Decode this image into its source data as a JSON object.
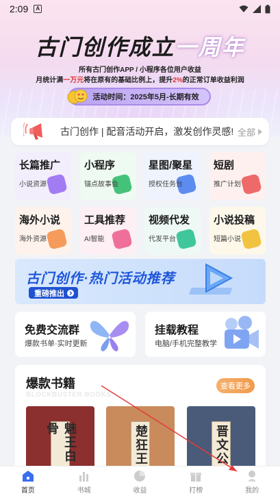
{
  "status": {
    "time": "2:09",
    "notif_letter": "A"
  },
  "hero": {
    "title_a": "古门创作成立",
    "title_b": "一周年",
    "sub1": "所有古门创作APP / 小程序各位用户收益",
    "sub2_a": "月统计满",
    "sub2_red1": "一万元",
    "sub2_b": "将在原有的基础比例上，提升",
    "sub2_red2": "2%",
    "sub2_c": "的正常订单收益利润",
    "period": "活动时间：2025年5月-长期有效"
  },
  "notice": {
    "text": "古门创作 | 配音活动开启，激发创作灵感!",
    "all": "全部"
  },
  "cards": [
    {
      "title": "长篇推广",
      "sub": "小说资源",
      "color": "#f3eefc",
      "icon": "#a27cf3"
    },
    {
      "title": "小程序",
      "sub": "锚点故事会",
      "color": "#eefaf2",
      "icon": "#45c27a"
    },
    {
      "title": "星图/聚星",
      "sub": "授权任务台",
      "color": "#eef3fd",
      "icon": "#5d8cf0"
    },
    {
      "title": "短剧",
      "sub": "推广计划",
      "color": "#fdf0ef",
      "icon": "#ee6a6a"
    },
    {
      "title": "海外小说",
      "sub": "海外资源",
      "color": "#fdf3ec",
      "icon": "#f59b5c"
    },
    {
      "title": "工具推荐",
      "sub": "AI智能",
      "color": "#fdeff4",
      "icon": "#ef6f9a"
    },
    {
      "title": "视频代发",
      "sub": "代发平台",
      "color": "#eef9f6",
      "icon": "#3fc79b"
    },
    {
      "title": "小说投稿",
      "sub": "短篇小说",
      "color": "#fdf8ea",
      "icon": "#f2c341"
    }
  ],
  "promo": {
    "title": "古门创作·热门活动推荐",
    "badge": "重磅推出"
  },
  "wide_cards": [
    {
      "title": "免费交流群",
      "sub": "爆款书单·实时更新"
    },
    {
      "title": "挂载教程",
      "sub": "电脑/手机完整教学"
    }
  ],
  "books": {
    "title": "爆款书籍",
    "title_en": "BLOCKBUSTER BOOKS",
    "more": "查看更多",
    "items": [
      {
        "label": "魅王白骨",
        "bg": "#8c2f2f"
      },
      {
        "label": "楚狂王",
        "bg": "#c98a5c"
      },
      {
        "label": "晋文公",
        "bg": "#4a5b7a"
      }
    ]
  },
  "nav": [
    {
      "label": "首页",
      "active": true
    },
    {
      "label": "书城",
      "active": false
    },
    {
      "label": "收益",
      "active": false
    },
    {
      "label": "打榜",
      "active": false
    },
    {
      "label": "我的",
      "active": false
    }
  ]
}
